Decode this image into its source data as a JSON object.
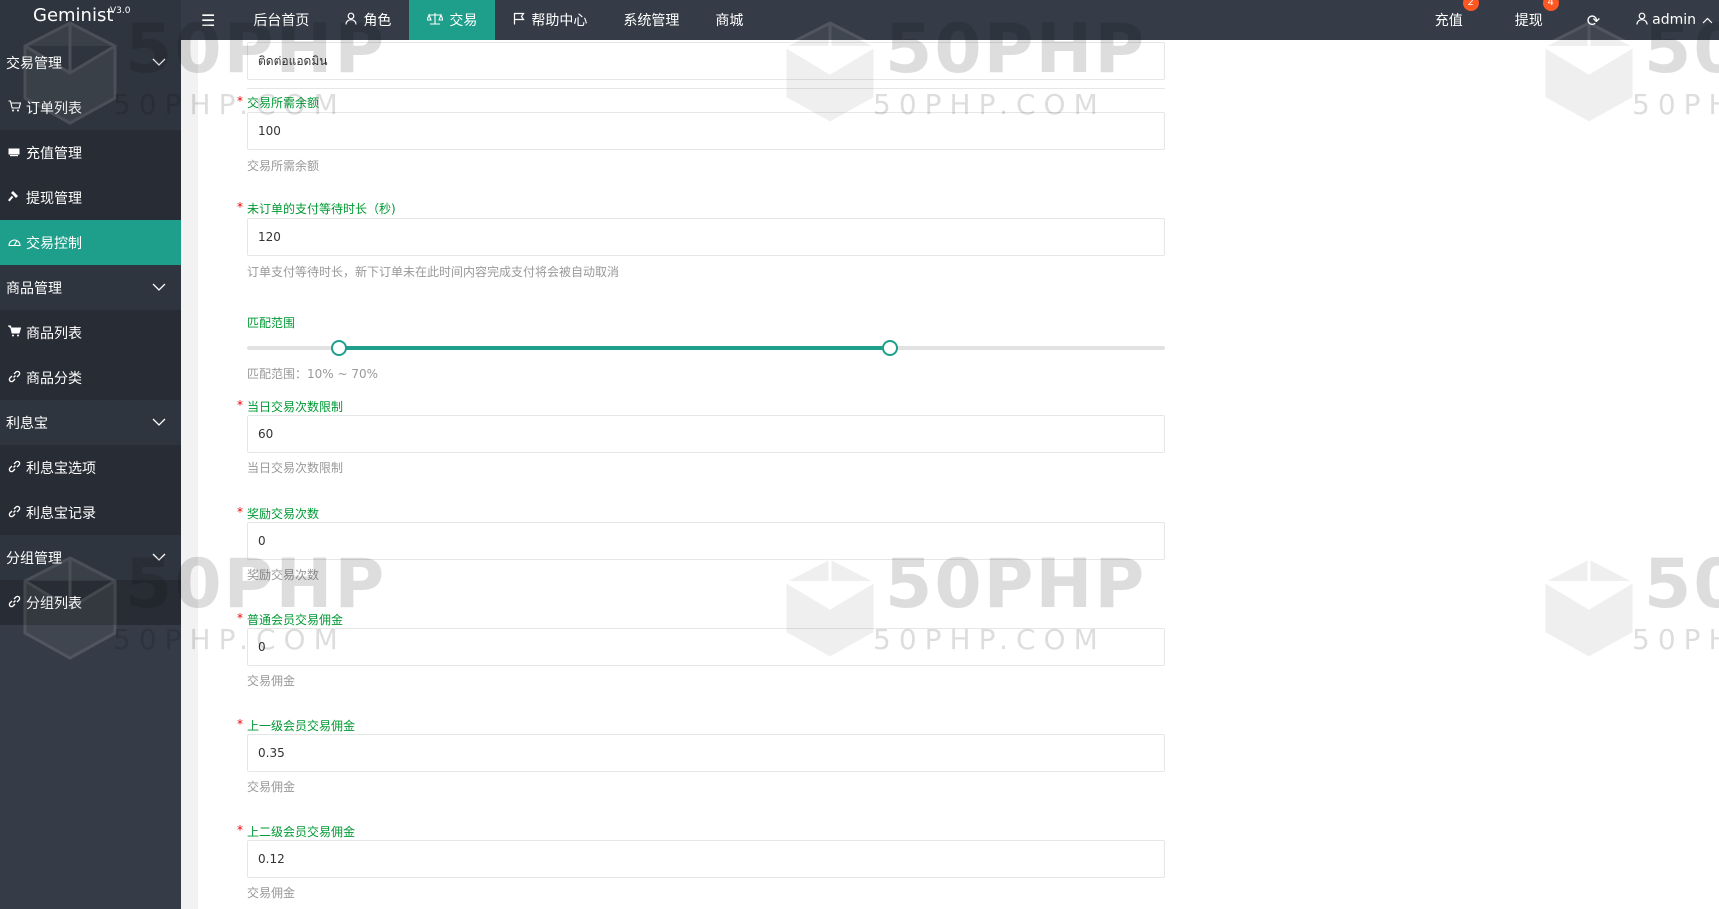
{
  "app": {
    "name": "Geminist",
    "version": "V3.0"
  },
  "topnav": {
    "items": [
      {
        "label": "后台首页",
        "icon": ""
      },
      {
        "label": "角色",
        "icon": "person-icon"
      },
      {
        "label": "交易",
        "icon": "scale-icon"
      },
      {
        "label": "帮助中心",
        "icon": "flag-icon"
      },
      {
        "label": "系统管理",
        "icon": ""
      },
      {
        "label": "商城",
        "icon": ""
      }
    ],
    "recharge": {
      "label": "充值",
      "badge": "2"
    },
    "withdraw": {
      "label": "提现",
      "badge": "4"
    },
    "user": {
      "label": "admin"
    }
  },
  "sidebar": {
    "trade_group": "交易管理",
    "order_list": "订单列表",
    "recharge_mgmt": "充值管理",
    "withdraw_mgmt": "提现管理",
    "trade_control": "交易控制",
    "goods_group": "商品管理",
    "goods_list": "商品列表",
    "goods_category": "商品分类",
    "interest_group": "利息宝",
    "interest_options": "利息宝选项",
    "interest_records": "利息宝记录",
    "group_group": "分组管理",
    "group_list": "分组列表"
  },
  "form": {
    "top_value": "ติดต่อแอดมิน",
    "balance": {
      "label": "交易所需余额",
      "value": "100",
      "help": "交易所需余额"
    },
    "wait": {
      "label": "未订单的支付等待时长（秒)",
      "value": "120",
      "help": "订单支付等待时长，新下订单未在此时间内容完成支付将会被自动取消"
    },
    "range": {
      "label": "匹配范围",
      "min_percent": 10,
      "max_percent": 70,
      "help": "匹配范围：10% ~ 70%"
    },
    "daily_limit": {
      "label": "当日交易次数限制",
      "value": "60",
      "help": "当日交易次数限制"
    },
    "bonus_count": {
      "label": "奖励交易次数",
      "value": "0",
      "help": "奖励交易次数"
    },
    "normal_commission": {
      "label": "普通会员交易佣金",
      "value": "0",
      "help": "交易佣金"
    },
    "level1_commission": {
      "label": "上一级会员交易佣金",
      "value": "0.35",
      "help": "交易佣金"
    },
    "level2_commission": {
      "label": "上二级会员交易佣金",
      "value": "0.12",
      "help": "交易佣金"
    }
  },
  "watermark": {
    "big": "50PHP",
    "small": "50PHP.COM"
  },
  "colors": {
    "accent": "#1e9f8b",
    "topbar": "#363c47",
    "sidebar": "#282c34",
    "label": "#009933",
    "badge": "#ff5722"
  }
}
